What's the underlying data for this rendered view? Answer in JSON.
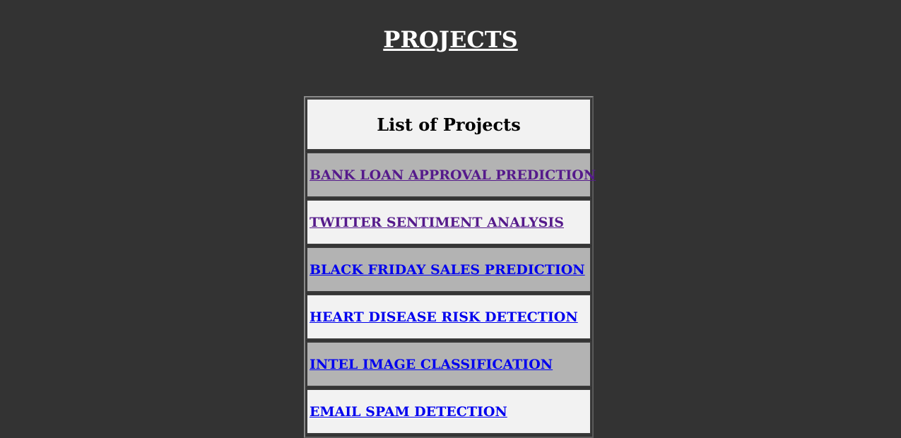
{
  "page": {
    "title": "PROJECTS",
    "background": "#333333"
  },
  "table": {
    "header": "List of Projects",
    "rows": [
      {
        "label": "BANK LOAN APPROVAL PREDICTION",
        "visited": true
      },
      {
        "label": "TWITTER SENTIMENT ANALYSIS",
        "visited": true
      },
      {
        "label": "BLACK FRIDAY SALES PREDICTION",
        "visited": false
      },
      {
        "label": "HEART DISEASE RISK DETECTION",
        "visited": false
      },
      {
        "label": "INTEL IMAGE CLASSIFICATION",
        "visited": false
      },
      {
        "label": "EMAIL SPAM DETECTION",
        "visited": false
      }
    ],
    "colors": {
      "shaded_row": "#b3b3b3",
      "light_row": "#f2f2f2",
      "visited_link": "#551a8b",
      "unvisited_link": "#0000ee"
    }
  }
}
